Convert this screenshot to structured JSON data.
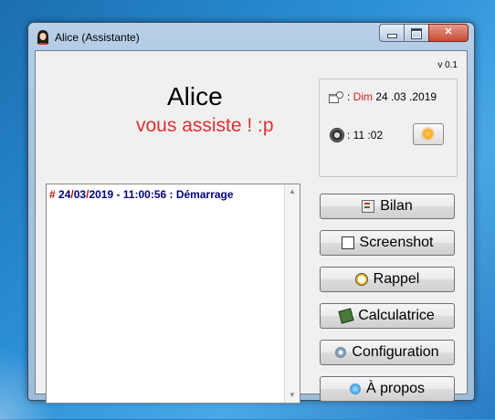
{
  "window": {
    "title": "Alice (Assistante)"
  },
  "caption_buttons": {
    "minimize": "minimize",
    "maximize": "maximize",
    "close": "✕"
  },
  "header": {
    "version": "v 0.1",
    "app_name": "Alice",
    "tagline": "vous assiste ! :p"
  },
  "info": {
    "date_sep": " : ",
    "day": "Dim",
    "date": "24 .03 .2019",
    "time_sep": " : ",
    "time": "11 :02"
  },
  "log": {
    "line1": {
      "hash": "#",
      "day": "24",
      "slash1": "/",
      "month": "03",
      "slash2": "/",
      "rest": "2019 - 11:00:56 : Démarrage"
    }
  },
  "actions": [
    {
      "label": "Bilan",
      "icon": "report-icon"
    },
    {
      "label": "Screenshot",
      "icon": "screenshot-icon"
    },
    {
      "label": "Rappel",
      "icon": "alarm-clock-icon"
    },
    {
      "label": "Calculatrice",
      "icon": "calculator-icon"
    },
    {
      "label": "Configuration",
      "icon": "gears-icon"
    },
    {
      "label": "À propos",
      "icon": "speech-bubble-icon"
    }
  ]
}
